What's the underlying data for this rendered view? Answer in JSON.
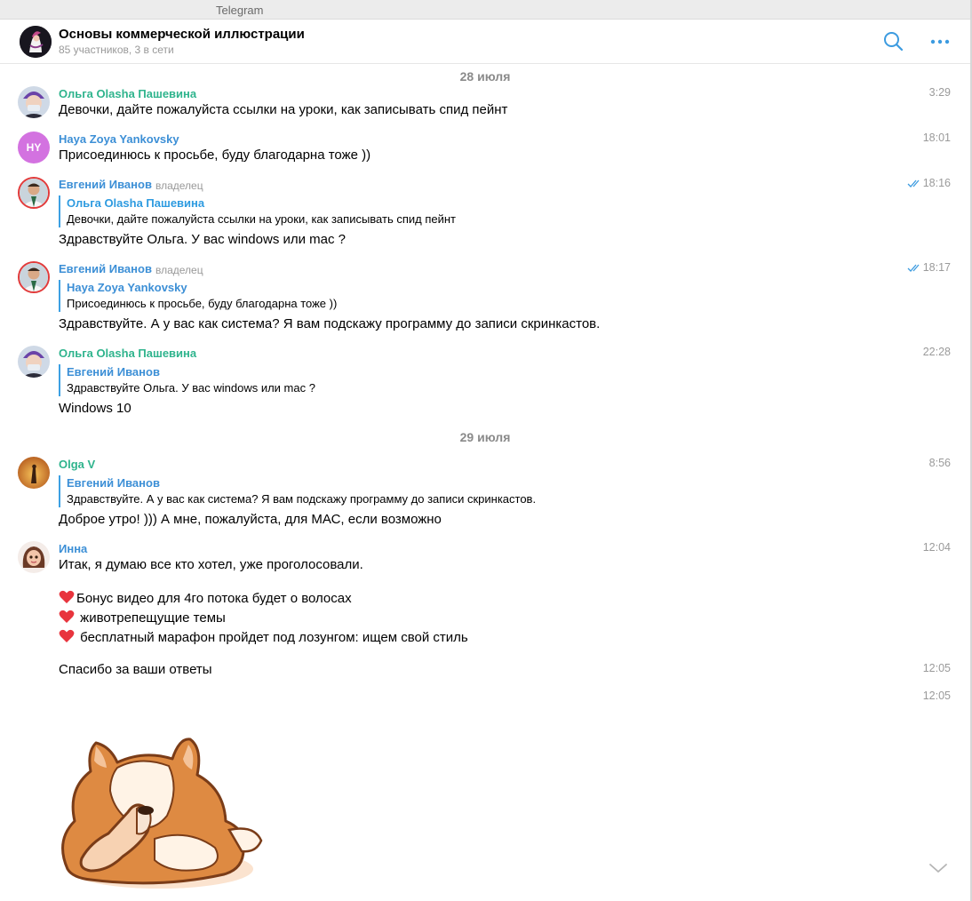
{
  "app": {
    "window_title": "Telegram"
  },
  "header": {
    "chat_title": "Основы коммерческой иллюстрации",
    "chat_subtitle": "85 участников, 3 в сети",
    "search_icon": "search-icon",
    "more_icon": "more-icon"
  },
  "colors": {
    "accent": "#3c9be0",
    "sender_green": "#2fb48d",
    "sender_blue": "#3c8fd6",
    "muted": "#9a9a9a"
  },
  "dates": [
    "28 июля",
    "29 июля"
  ],
  "messages": [
    {
      "sender": "Ольга Olasha Пашевина",
      "text": "Девочки, дайте пожалуйста ссылки на уроки, как записывать спид пейнт",
      "time": "3:29"
    },
    {
      "sender": "Haya Zoya Yankovsky",
      "initials": "HY",
      "text": "Присоединюсь к просьбе, буду благодарна тоже ))",
      "time": "18:01"
    },
    {
      "sender": "Евгений Иванов",
      "role": "владелец",
      "reply_name": "Ольга Olasha Пашевина",
      "reply_text": "Девочки, дайте пожалуйста ссылки на уроки, как записывать спид пейнт",
      "text": "Здравствуйте Ольга. У вас windows или mac ?",
      "time": "18:16",
      "read": true
    },
    {
      "sender": "Евгений Иванов",
      "role": "владелец",
      "reply_name": "Haya Zoya Yankovsky",
      "reply_text": "Присоединюсь к просьбе, буду благодарна тоже ))",
      "text": "Здравствуйте. А у вас как система? Я вам подскажу программу до записи скринкастов.",
      "time": "18:17",
      "read": true
    },
    {
      "sender": "Ольга Olasha Пашевина",
      "reply_name": "Евгений Иванов",
      "reply_text": "Здравствуйте Ольга. У вас windows или mac ?",
      "text": "Windows 10",
      "time": "22:28"
    },
    {
      "sender": "Olga V",
      "reply_name": "Евгений Иванов",
      "reply_text": "Здравствуйте. А у вас как система? Я вам подскажу программу до записи скринкастов.",
      "text": "Доброе утро! ))) А мне, пожалуйста, для МАС, если возможно",
      "time": "8:56"
    },
    {
      "sender": "Инна",
      "text": "Итак, я думаю все кто хотел, уже проголосовали.",
      "time": "12:04",
      "list": [
        "Бонус видео для 4го потока будет о волосах",
        " животрепещущие темы",
        " бесплатный марафон пройдет под лозунгом: ищем свой стиль"
      ]
    },
    {
      "text": "Спасибо за ваши ответы",
      "time": "12:05"
    },
    {
      "time": "12:05",
      "sticker": "corgi-sticker"
    }
  ]
}
